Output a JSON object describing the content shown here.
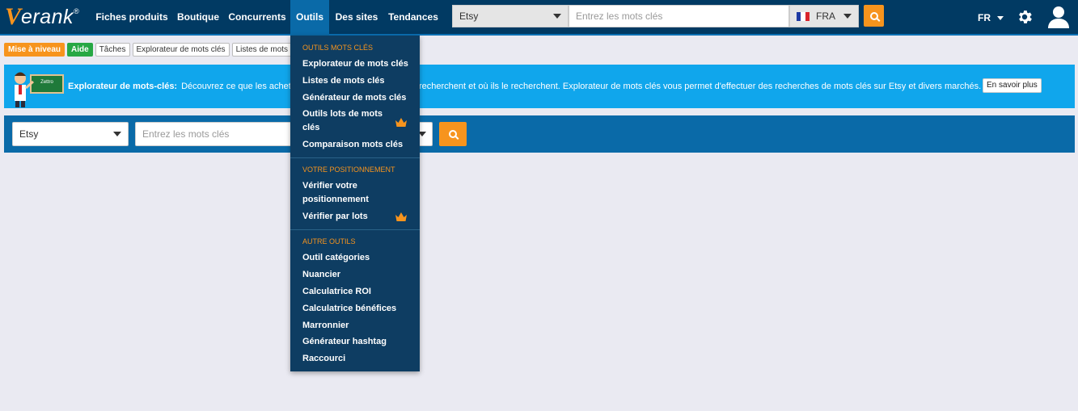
{
  "brand": {
    "logo_mark": "V",
    "logo_word": "erank",
    "logo_reg": "®"
  },
  "nav": {
    "items": [
      "Fiches produits",
      "Boutique",
      "Concurrents",
      "Outils",
      "Des sites",
      "Tendances"
    ],
    "active": "Outils"
  },
  "top_search": {
    "platform": "Etsy",
    "placeholder": "Entrez les mots clés",
    "country": "FRA"
  },
  "lang": "FR",
  "tags": [
    "Mise à niveau",
    "Aide",
    "Tâches",
    "Explorateur de mots clés",
    "Listes de mots clés"
  ],
  "banner": {
    "title": "Explorateur de mots-clés:",
    "text_start": "Découvrez ce que les achete",
    "text_end": "recherchent et où ils le recherchent. Explorateur de mots clés vous permet d'effectuer des recherches de mots clés sur Etsy et divers marchés.",
    "button": "En savoir plus",
    "board_label": "Zettro"
  },
  "main_search": {
    "platform": "Etsy",
    "placeholder": "Entrez les mots clés"
  },
  "dropdown": {
    "section_keywords": "OUTILS MOTS CLÉS",
    "keywords": [
      "Explorateur de mots clés",
      "Listes de mots clés",
      "Générateur de mots clés",
      "Outils lots de mots clés",
      "Comparaison mots clés"
    ],
    "section_ranking": "VOTRE POSITIONNEMENT",
    "ranking": [
      "Vérifier votre positionnement",
      "Vérifier par lots"
    ],
    "section_other": "AUTRE OUTILS",
    "other": [
      "Outil catégories",
      "Nuancier",
      "Calculatrice ROI",
      "Calculatrice bénéfices",
      "Marronnier",
      "Générateur hashtag",
      "Raccourci"
    ]
  },
  "colors": {
    "nav_bg": "#013a63",
    "accent_orange": "#f7941d",
    "banner_blue": "#10a6ec",
    "search_block": "#0a6aa8",
    "dropdown_bg": "#0e3d62"
  }
}
